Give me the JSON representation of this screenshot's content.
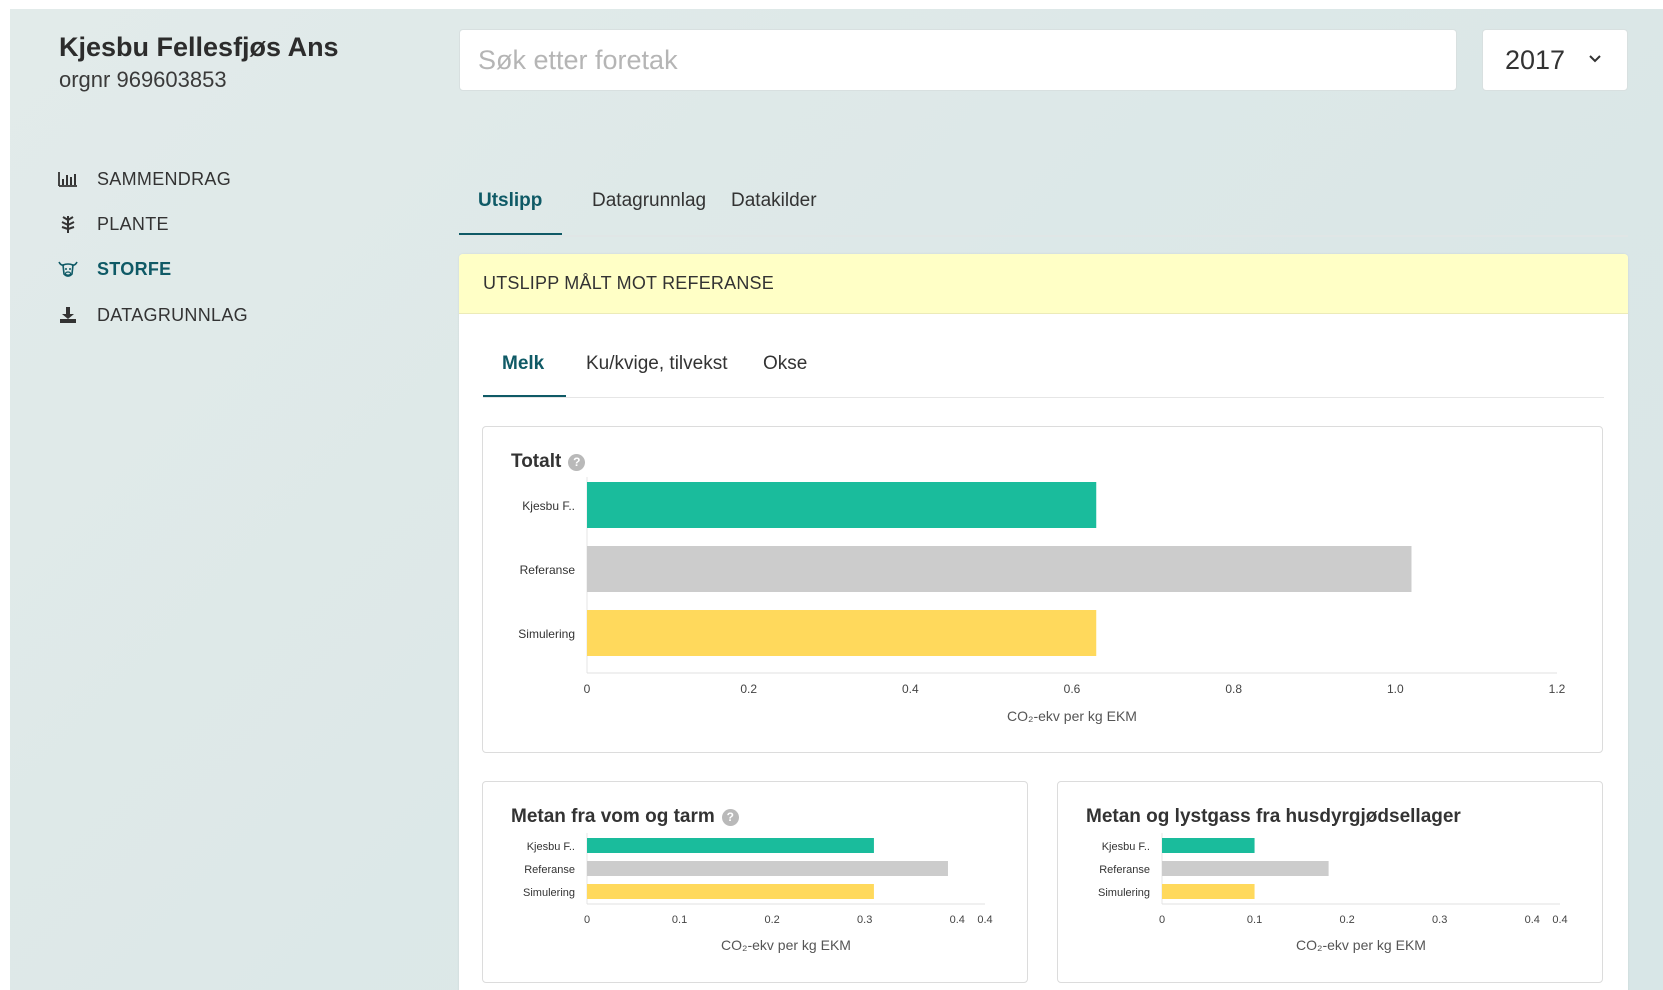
{
  "company": {
    "name": "Kjesbu Fellesfjøs Ans",
    "orgnr": "orgnr 969603853"
  },
  "search": {
    "placeholder": "Søk etter foretak"
  },
  "year": {
    "value": "2017"
  },
  "sidebar": {
    "items": [
      {
        "label": "SAMMENDRAG",
        "icon": "bar-chart-icon"
      },
      {
        "label": "PLANTE",
        "icon": "plant-icon"
      },
      {
        "label": "STORFE",
        "icon": "cow-icon",
        "active": true
      },
      {
        "label": "DATAGRUNNLAG",
        "icon": "download-icon"
      }
    ]
  },
  "tabs": [
    {
      "label": "Utslipp",
      "active": true
    },
    {
      "label": "Datagrunnlag"
    },
    {
      "label": "Datakilder"
    }
  ],
  "panel": {
    "header": "UTSLIPP MÅLT MOT REFERANSE"
  },
  "subtabs": [
    {
      "label": "Melk",
      "active": true
    },
    {
      "label": "Ku/kvige, tilvekst"
    },
    {
      "label": "Okse"
    }
  ],
  "colors": {
    "farm": "#1abc9c",
    "reference": "#cccccc",
    "simulation": "#ffd95c",
    "accent": "#0f5a66"
  },
  "chart_data": [
    {
      "type": "bar",
      "orientation": "horizontal",
      "title": "Totalt",
      "categories": [
        "Kjesbu F..",
        "Referanse",
        "Simulering"
      ],
      "values": [
        0.63,
        1.02,
        0.63
      ],
      "xlabel": "CO₂-ekv per kg EKM",
      "xlim": [
        0,
        1.2
      ],
      "xticks": [
        "0",
        "0.2",
        "0.4",
        "0.6",
        "0.8",
        "1.0",
        "1.2"
      ],
      "xtick_values": [
        0,
        0.2,
        0.4,
        0.6,
        0.8,
        1.0,
        1.2
      ]
    },
    {
      "type": "bar",
      "orientation": "horizontal",
      "title": "Metan fra vom og tarm",
      "categories": [
        "Kjesbu F..",
        "Referanse",
        "Simulering"
      ],
      "values": [
        0.31,
        0.39,
        0.31
      ],
      "xlabel": "CO₂-ekv per kg EKM",
      "xlim": [
        0,
        0.43
      ],
      "xticks": [
        "0",
        "0.1",
        "0.2",
        "0.3",
        "0.4",
        "0.4"
      ],
      "xtick_values": [
        0,
        0.1,
        0.2,
        0.3,
        0.4,
        0.43
      ]
    },
    {
      "type": "bar",
      "orientation": "horizontal",
      "title": "Metan og lystgass fra husdyrgjødsellager",
      "categories": [
        "Kjesbu F..",
        "Referanse",
        "Simulering"
      ],
      "values": [
        0.1,
        0.18,
        0.1
      ],
      "xlabel": "CO₂-ekv per kg EKM",
      "xlim": [
        0,
        0.43
      ],
      "xticks": [
        "0",
        "0.1",
        "0.2",
        "0.3",
        "0.4",
        "0.4"
      ],
      "xtick_values": [
        0,
        0.1,
        0.2,
        0.3,
        0.4,
        0.43
      ]
    }
  ]
}
